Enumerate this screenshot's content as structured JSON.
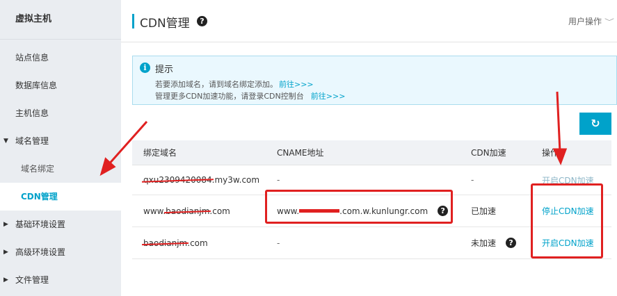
{
  "sidebar": {
    "title": "虚拟主机",
    "items": [
      {
        "label": "站点信息"
      },
      {
        "label": "数据库信息"
      },
      {
        "label": "主机信息"
      },
      {
        "label": "域名管理"
      },
      {
        "label": "域名绑定"
      },
      {
        "label": "CDN管理"
      },
      {
        "label": "基础环境设置"
      },
      {
        "label": "高级环境设置"
      },
      {
        "label": "文件管理"
      }
    ]
  },
  "header": {
    "title": "CDN管理",
    "help_glyph": "?",
    "user_ops": "用户操作",
    "user_ops_chevron": "﹀"
  },
  "tip": {
    "icon_glyph": "i",
    "title": "提示",
    "line1": "若要添加域名，请到域名绑定添加。",
    "line1_link": "前往>>>",
    "line2": "管理更多CDN加速功能，请登录CDN控制台",
    "line2_link": "前往>>>"
  },
  "refresh": {
    "glyph": "↻"
  },
  "table": {
    "headers": [
      "绑定域名",
      "CNAME地址",
      "CDN加速",
      "操作"
    ],
    "rows": [
      {
        "domain_prefix": "qxu2309420084",
        "domain_suffix": ".my3w.com",
        "cname": "-",
        "cdn": "-",
        "action": "开启CDN加速"
      },
      {
        "domain_prefix": "www.",
        "domain_strike": "baodianjm",
        "domain_suffix": ".com",
        "cname_prefix": "www.",
        "cname_suffix": ".com.w.kunlungr.com",
        "cdn": "已加速",
        "action": "停止CDN加速"
      },
      {
        "domain_strike": "baodianjm",
        "domain_suffix": ".com",
        "cname": "-",
        "cdn": "未加速",
        "action": "开启CDN加速"
      }
    ]
  },
  "colors": {
    "accent": "#00a2ca",
    "annotation": "#e02020",
    "sidebar_bg": "#eaedf1"
  }
}
